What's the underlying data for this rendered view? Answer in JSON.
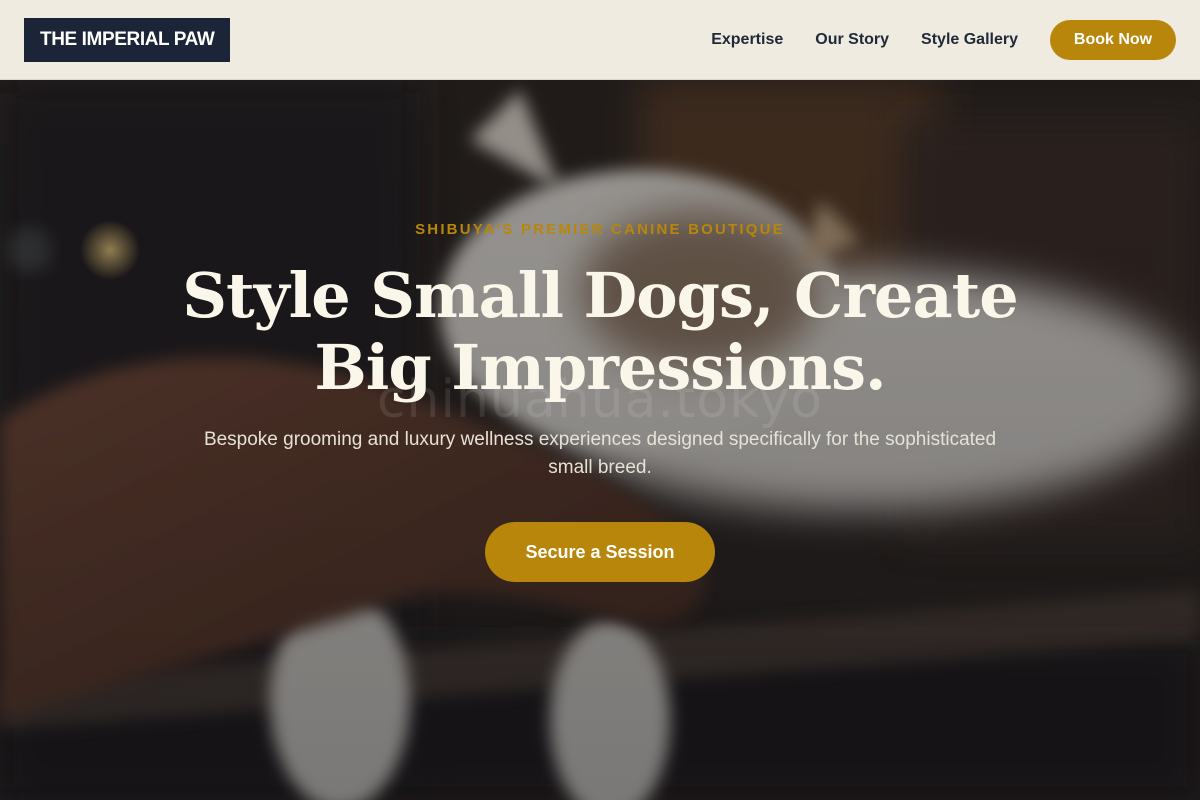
{
  "brand": {
    "logo_text": "THE IMPERIAL PAW"
  },
  "nav": {
    "links": [
      {
        "label": "Expertise"
      },
      {
        "label": "Our Story"
      },
      {
        "label": "Style Gallery"
      }
    ],
    "cta_label": "Book Now"
  },
  "hero": {
    "eyebrow": "SHIBUYA'S PREMIER CANINE BOUTIQUE",
    "headline": "Style Small Dogs, Create Big Impressions.",
    "watermark": "chihuahua.tokyo",
    "subtext": "Bespoke grooming and luxury wellness experiences designed specifically for the sophisticated small breed.",
    "cta_label": "Secure a Session",
    "background": "photo of a hand petting a cat"
  },
  "colors": {
    "accent": "#b8860b",
    "nav_bg": "#efebe0",
    "logo_bg": "#1c2438",
    "nav_text": "#1f2937",
    "headline_text": "#fbf6ea"
  }
}
